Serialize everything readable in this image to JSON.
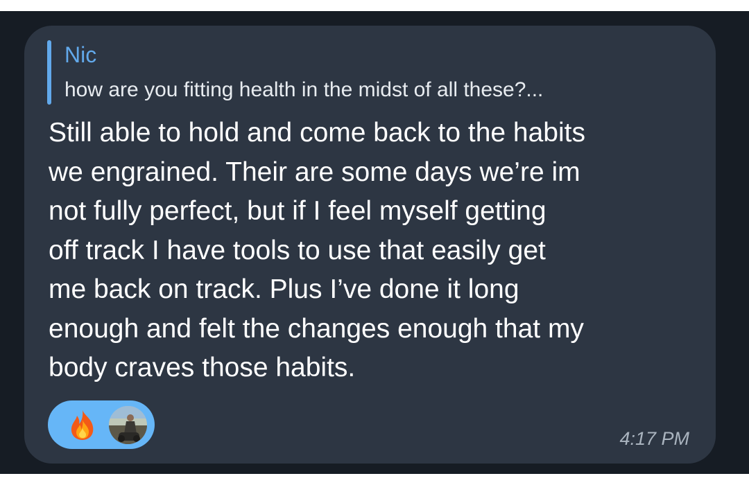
{
  "reply": {
    "author": "Nic",
    "preview": "how are you fitting health in the midst of all these?..."
  },
  "message": {
    "lines": [
      "Still able to hold and come back to the habits",
      "we engrained. Their are some days we’re im",
      "not fully perfect, but if I feel myself getting",
      "off track I have tools to use that easily get",
      "me back on track. Plus I’ve done it long",
      "enough and felt the changes enough that my",
      "body craves those habits."
    ],
    "time": "4:17 PM"
  },
  "reaction": {
    "emoji_icon": "fire-icon",
    "reactor": "avatar"
  },
  "colors": {
    "background": "#161c24",
    "bubble": "#2d3643",
    "accent": "#62a9eb",
    "reaction_pill": "#66b6f7"
  }
}
